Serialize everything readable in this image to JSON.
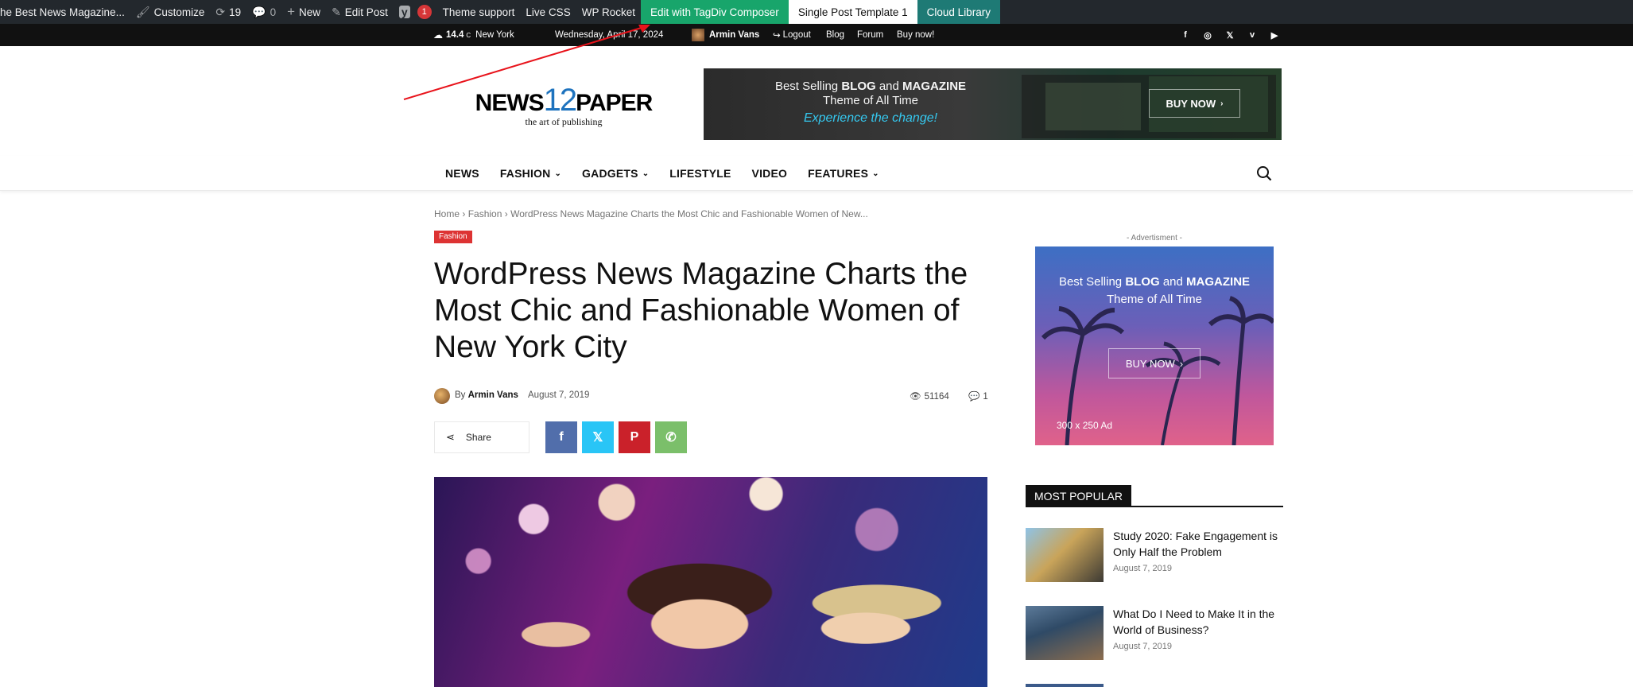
{
  "adminbar": {
    "site_name": "he Best News Magazine...",
    "customize": "Customize",
    "updates_count": "19",
    "comments_count": "0",
    "new_label": "New",
    "edit_post": "Edit Post",
    "seo_badge": "1",
    "theme_support": "Theme support",
    "live_css": "Live CSS",
    "wp_rocket": "WP Rocket",
    "edit_tagdiv": "Edit with TagDiv Composer",
    "single_post_template": "Single Post Template 1",
    "cloud_library": "Cloud Library",
    "colors": {
      "green": "#18a56b",
      "teal": "#1e7a75",
      "bg": "#23282d"
    }
  },
  "topbar": {
    "temperature": "14.4",
    "temp_unit": "C",
    "city": "New York",
    "date": "Wednesday, April 17, 2024",
    "user": "Armin Vans",
    "logout": "Logout",
    "links": [
      "Blog",
      "Forum",
      "Buy now!"
    ],
    "socials": [
      "facebook-icon",
      "instagram-icon",
      "x-icon",
      "vimeo-icon",
      "youtube-icon"
    ]
  },
  "logo": {
    "left": "NEWS",
    "number": "12",
    "right": "PAPER",
    "tagline": "the art of publishing"
  },
  "banner_top": {
    "line1_pre": "Best Selling ",
    "line1_b1": "BLOG",
    "line1_mid": " and ",
    "line1_b2": "MAGAZINE",
    "line2": "Theme of All Time",
    "line3": "Experience the change!",
    "button": "BUY NOW"
  },
  "nav": {
    "items": [
      {
        "label": "NEWS",
        "dropdown": false
      },
      {
        "label": "FASHION",
        "dropdown": true
      },
      {
        "label": "GADGETS",
        "dropdown": true
      },
      {
        "label": "LIFESTYLE",
        "dropdown": false
      },
      {
        "label": "VIDEO",
        "dropdown": false
      },
      {
        "label": "FEATURES",
        "dropdown": true
      }
    ]
  },
  "article": {
    "breadcrumb": [
      "Home",
      "Fashion",
      "WordPress News Magazine Charts the Most Chic and Fashionable Women of New..."
    ],
    "category": "Fashion",
    "title": "WordPress News Magazine Charts the Most Chic and Fashionable Women of New York City",
    "by": "By",
    "author": "Armin Vans",
    "date": "August 7, 2019",
    "views": "51164",
    "comments": "1",
    "share_label": "Share",
    "share_colors": {
      "facebook": "#516eab",
      "twitter": "#29c5f6",
      "pinterest": "#ca212a",
      "whatsapp": "#7bbf6a"
    }
  },
  "sidebar": {
    "ad_label": "- Advertisment -",
    "ad_line1_pre": "Best Selling ",
    "ad_line1_b1": "BLOG",
    "ad_line1_mid": " and ",
    "ad_line1_b2": "MAGAZINE",
    "ad_line2": "Theme of All Time",
    "ad_button": "BUY NOW",
    "ad_size": "300 x 250 Ad",
    "most_popular": "MOST POPULAR",
    "popular": [
      {
        "title": "Study 2020: Fake Engagement is Only Half the Problem",
        "date": "August 7, 2019"
      },
      {
        "title": "What Do I Need to Make It in the World of Business?",
        "date": "August 7, 2019"
      }
    ]
  }
}
